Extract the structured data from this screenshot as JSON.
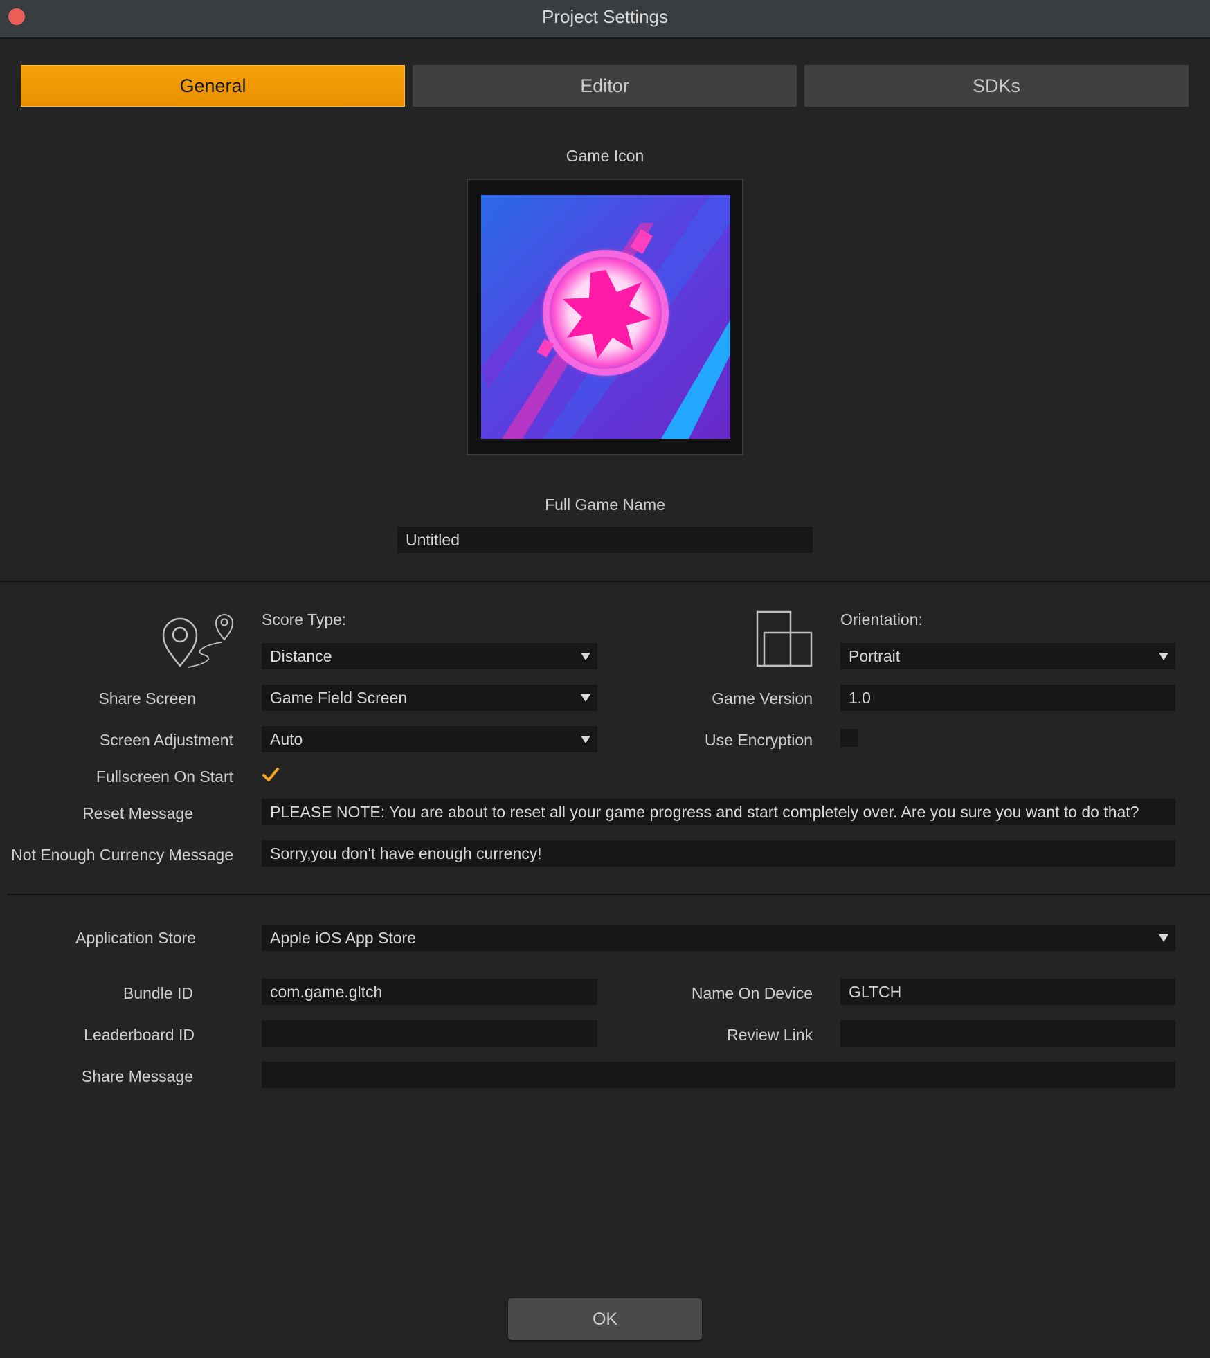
{
  "window": {
    "title": "Project Settings"
  },
  "tabs": [
    {
      "label": "General",
      "active": true
    },
    {
      "label": "Editor",
      "active": false
    },
    {
      "label": "SDKs",
      "active": false
    }
  ],
  "game_icon": {
    "label": "Game Icon"
  },
  "full_game_name": {
    "label": "Full Game Name",
    "value": "Untitled"
  },
  "score_type": {
    "label": "Score Type:",
    "value": "Distance"
  },
  "orientation": {
    "label": "Orientation:",
    "value": "Portrait"
  },
  "share_screen": {
    "label": "Share Screen",
    "value": "Game Field Screen"
  },
  "game_version": {
    "label": "Game Version",
    "value": "1.0"
  },
  "screen_adjustment": {
    "label": "Screen Adjustment",
    "value": "Auto"
  },
  "use_encryption": {
    "label": "Use Encryption",
    "checked": false
  },
  "fullscreen_on_start": {
    "label": "Fullscreen On Start",
    "checked": true
  },
  "reset_message": {
    "label": "Reset Message",
    "value": "PLEASE NOTE:  You are about to reset all your game progress and start completely over. Are you sure you want to do that?"
  },
  "currency_message": {
    "label": "Not Enough Currency Message",
    "value": "Sorry,you don't have enough currency!"
  },
  "application_store": {
    "label": "Application Store",
    "value": "Apple iOS App Store"
  },
  "bundle_id": {
    "label": "Bundle ID",
    "value": "com.game.gltch"
  },
  "name_on_device": {
    "label": "Name On Device",
    "value": "GLTCH"
  },
  "leaderboard_id": {
    "label": "Leaderboard ID",
    "value": ""
  },
  "review_link": {
    "label": "Review Link",
    "value": ""
  },
  "share_message": {
    "label": "Share Message",
    "value": ""
  },
  "ok_button": {
    "label": "OK"
  },
  "colors": {
    "accent": "#f39c05",
    "background": "#242424",
    "field": "#171717",
    "checkmark": "#f5a623"
  },
  "icons": {
    "score_type": "map-pin-route-icon",
    "orientation": "orientation-icon",
    "dropdown": "chevron-down-icon",
    "checkbox": "checkmark-icon"
  }
}
